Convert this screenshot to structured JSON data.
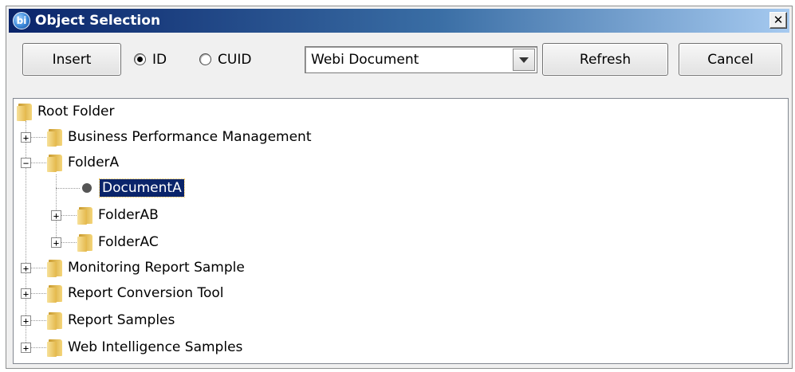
{
  "window": {
    "title": "Object Selection",
    "app_icon": "bi"
  },
  "toolbar": {
    "insert_label": "Insert",
    "radio_id_label": "ID",
    "radio_cuid_label": "CUID",
    "selected_radio": "ID",
    "doc_type_value": "Webi Document",
    "refresh_label": "Refresh",
    "cancel_label": "Cancel"
  },
  "tree": {
    "root": "Root Folder",
    "items": [
      {
        "label": "Business Performance Management",
        "expanded": false
      },
      {
        "label": "FolderA",
        "expanded": true
      },
      {
        "label": "DocumentA",
        "selected": true
      },
      {
        "label": "FolderAB",
        "expanded": false
      },
      {
        "label": "FolderAC",
        "expanded": false
      },
      {
        "label": "Monitoring Report Sample",
        "expanded": false
      },
      {
        "label": "Report Conversion Tool",
        "expanded": false
      },
      {
        "label": "Report Samples",
        "expanded": false
      },
      {
        "label": "Web Intelligence Samples",
        "expanded": false
      }
    ]
  },
  "colors": {
    "titlebar_start": "#0a246a",
    "titlebar_end": "#a6caf0",
    "selection": "#0a246a",
    "folder": "#f5d67a"
  }
}
